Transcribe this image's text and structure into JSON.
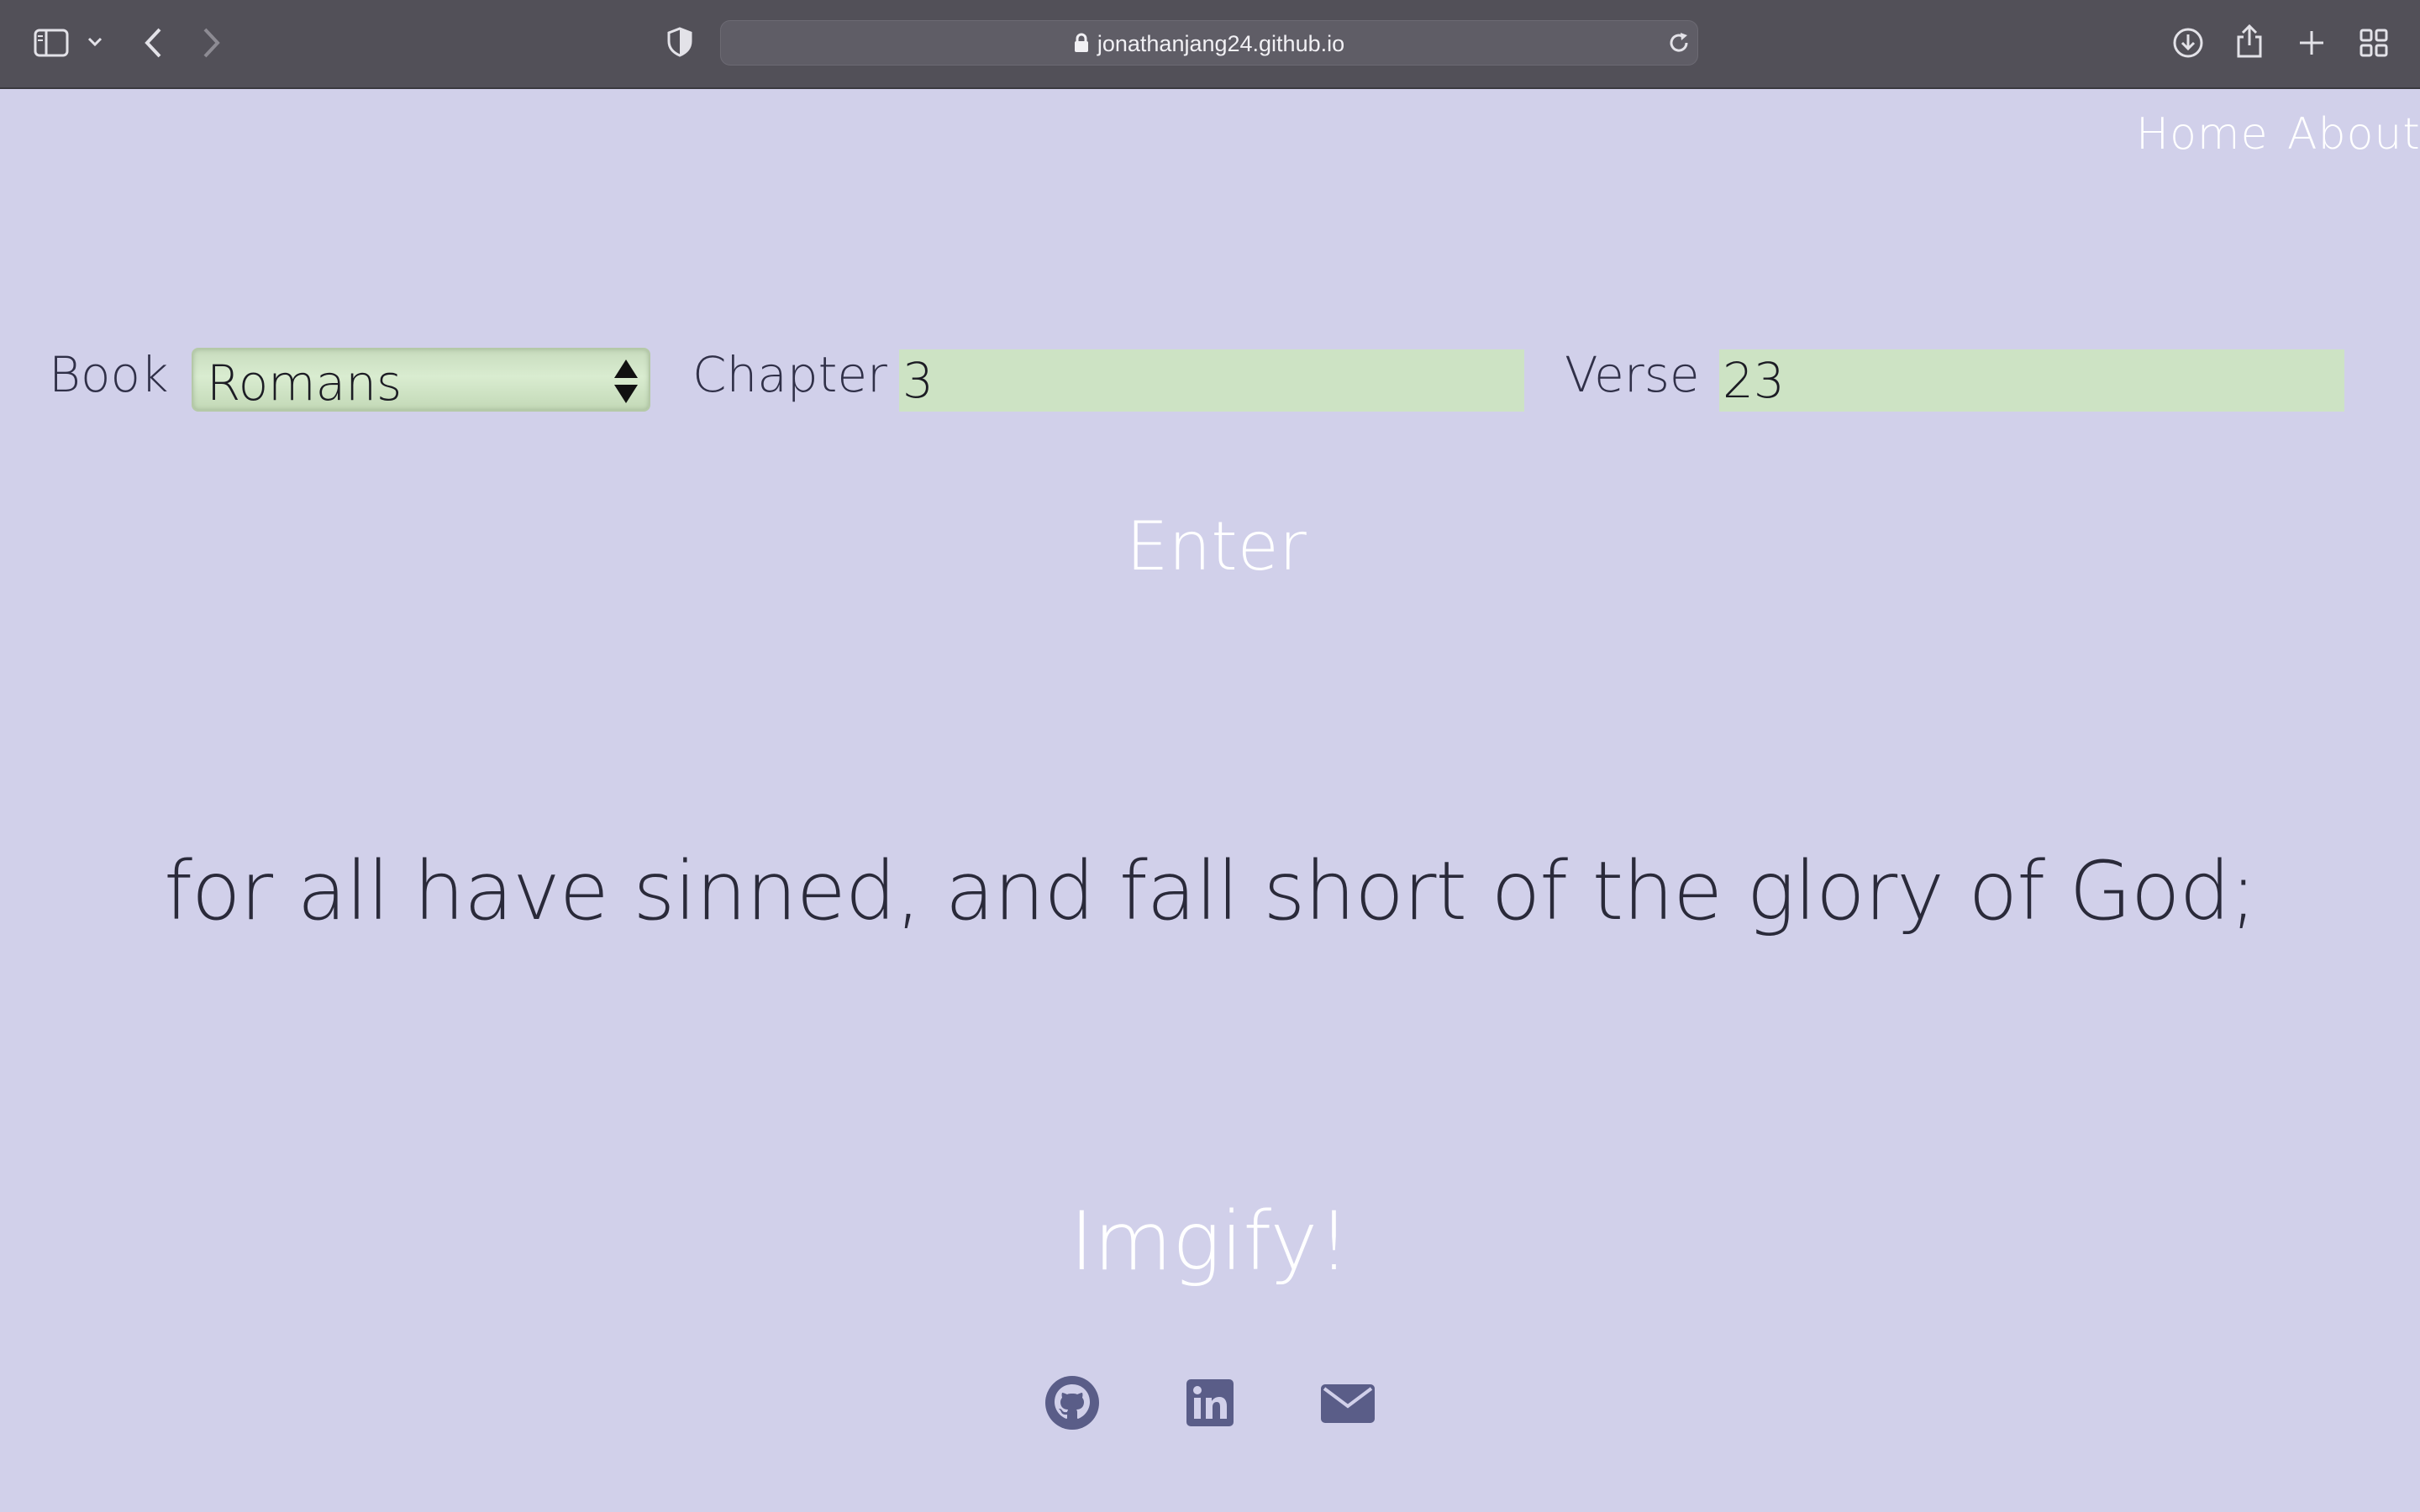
{
  "browser": {
    "url": "jonathanjang24.github.io",
    "icons": [
      "sidebar-icon",
      "chevron-down-icon",
      "back-icon",
      "forward-icon",
      "shield-icon",
      "lock-icon",
      "reload-icon",
      "download-icon",
      "share-icon",
      "new-tab-icon",
      "tab-overview-icon"
    ]
  },
  "nav": {
    "home_label": "Home",
    "about_label": "About"
  },
  "form": {
    "book_label": "Book",
    "book_value": "Romans",
    "chapter_label": "Chapter",
    "chapter_value": "3",
    "verse_label": "Verse",
    "verse_value": "23",
    "enter_label": "Enter"
  },
  "result": {
    "verse_text": "for all have sinned, and fall short of the glory of God;"
  },
  "imgify_label": "Imgify!",
  "footer": {
    "icons": [
      "github-icon",
      "linkedin-icon",
      "email-icon"
    ]
  },
  "colors": {
    "background": "#d1d0ea",
    "input_fill": "#cde3c4",
    "text_dark": "#2a2a3a",
    "text_light": "#ffffff",
    "social_icon": "#5a5d88",
    "toolbar": "#525058"
  }
}
